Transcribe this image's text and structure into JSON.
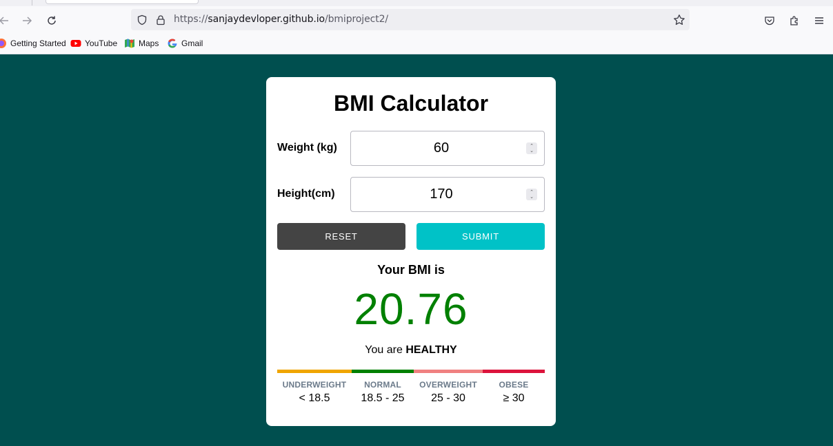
{
  "browser": {
    "url_prefix": "https://",
    "url_host": "sanjaydevloper.github.io",
    "url_path": "/bmiproject2/",
    "bookmarks": [
      {
        "label": "Getting Started",
        "icon": "firefox-icon"
      },
      {
        "label": "YouTube",
        "icon": "youtube-icon"
      },
      {
        "label": "Maps",
        "icon": "maps-icon"
      },
      {
        "label": "Gmail",
        "icon": "google-icon"
      }
    ]
  },
  "app": {
    "title": "BMI Calculator",
    "weight": {
      "label": "Weight (kg)",
      "value": "60"
    },
    "height": {
      "label": "Height(cm)",
      "value": "170"
    },
    "reset_label": "RESET",
    "submit_label": "SUBMIT",
    "result_heading": "Your BMI is",
    "bmi_value": "20.76",
    "status_prefix": "You are",
    "status_value": "HEALTHY",
    "categories": [
      {
        "name": "UNDERWEIGHT",
        "range": "< 18.5",
        "color": "#f0a500"
      },
      {
        "name": "NORMAL",
        "range": "18.5 - 25",
        "color": "#008000"
      },
      {
        "name": "OVERWEIGHT",
        "range": "25 - 30",
        "color": "#f08080"
      },
      {
        "name": "OBESE",
        "range": "≥ 30",
        "color": "#dc143c"
      }
    ]
  },
  "colors": {
    "page_bg": "#004f4f",
    "bmi_value": "#008000",
    "submit_bg": "#00c2c7",
    "reset_bg": "#444444"
  }
}
